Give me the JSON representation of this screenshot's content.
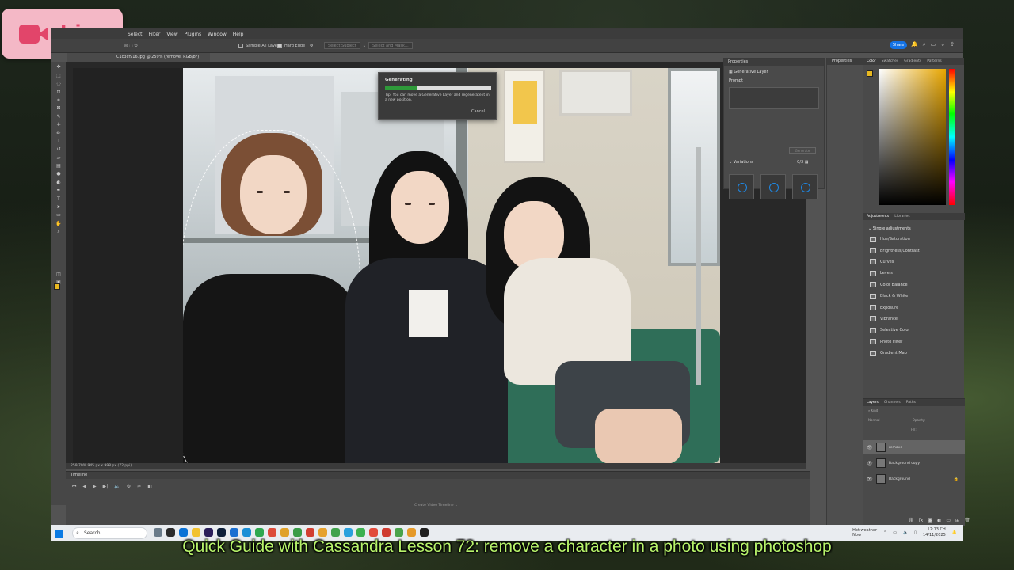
{
  "overlay": {
    "live_label": "Live",
    "caption": "Quick Guide with Cassandra Lesson 72: remove a character in a photo using photoshop"
  },
  "photoshop": {
    "menu": [
      "Select",
      "Filter",
      "View",
      "Plugins",
      "Window",
      "Help"
    ],
    "options_bar": {
      "sample_all_layers": "Sample All Layers",
      "hard_edge": "Hard Edge",
      "select_subject": "Select Subject",
      "select_and_mask": "Select and Mask..."
    },
    "share_label": "Share",
    "doc_tab": "C1c3cf916.jpg @ 259% (remove, RGB/8*)",
    "status_bar": "259.79%    945 px x 998 px (72 ppi)",
    "generating_dialog": {
      "title": "Generating",
      "progress": 0.3,
      "tip": "Tip: You can move a Generative Layer and regenerate it in a new position.",
      "cancel_label": "Cancel"
    },
    "timeline": {
      "title": "Timeline",
      "create_label": "Create Video Timeline"
    },
    "properties": {
      "title": "Properties",
      "layer_type": "Generative Layer",
      "prompt_label": "Prompt",
      "generate_label": "Generate",
      "variations_label": "Variations",
      "variations_count": "0/3"
    },
    "properties_strip_title": "Properties",
    "color_panel": {
      "tabs": [
        "Color",
        "Swatches",
        "Gradients",
        "Patterns"
      ],
      "foreground_color": "#e8b820"
    },
    "adjustments": {
      "tabs": [
        "Adjustments",
        "Libraries"
      ],
      "section": "Single adjustments",
      "items": [
        "Hue/Saturation",
        "Brightness/Contrast",
        "Curves",
        "Levels",
        "Color Balance",
        "Black & White",
        "Exposure",
        "Vibrance",
        "Selective Color",
        "Photo Filter",
        "Gradient Map"
      ]
    },
    "layers": {
      "tabs": [
        "Layers",
        "Channels",
        "Paths"
      ],
      "kind_label": "Kind",
      "blend_mode": "Normal",
      "opacity_label": "Opacity:",
      "fill_label": "Fill:",
      "items": [
        {
          "name": "remove",
          "selected": true,
          "locked": false
        },
        {
          "name": "Background copy",
          "selected": false,
          "locked": false
        },
        {
          "name": "Background",
          "selected": false,
          "locked": true
        }
      ]
    }
  },
  "taskbar": {
    "search_placeholder": "Search",
    "weather": "Hot weather",
    "weather_sub": "Now",
    "time": "12:13 CH",
    "date": "14/11/2025"
  }
}
